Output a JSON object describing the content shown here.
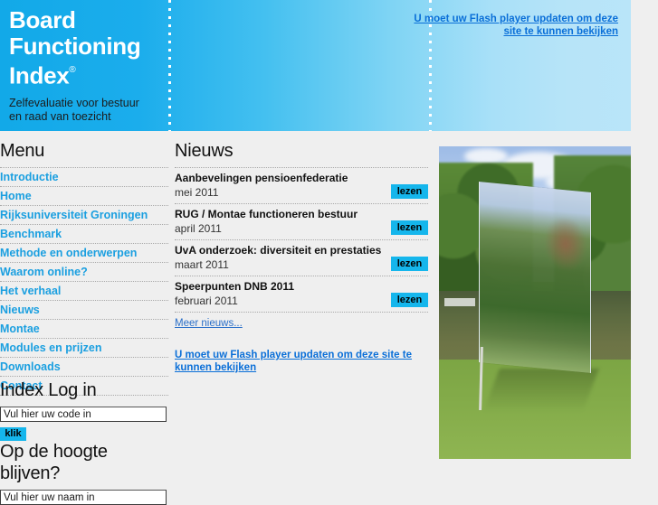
{
  "header": {
    "logo_line1": "Board",
    "logo_line2": "Functioning",
    "logo_line3": "Index",
    "logo_registered": "®",
    "tagline_line1": "Zelfevaluatie voor bestuur",
    "tagline_line2": "en raad van toezicht",
    "flash_notice": "U moet uw Flash player updaten om deze site te kunnen bekijken",
    "gradient_start": "#12a9e8",
    "gradient_end": "#b9e5f9"
  },
  "menu": {
    "title": "Menu",
    "items": [
      {
        "label": "Introductie"
      },
      {
        "label": "Home"
      },
      {
        "label": "Rijksuniversiteit Groningen"
      },
      {
        "label": "Benchmark"
      },
      {
        "label": "Methode en onderwerpen"
      },
      {
        "label": "Waarom online?"
      },
      {
        "label": "Het verhaal"
      },
      {
        "label": "Nieuws"
      },
      {
        "label": "Montae"
      },
      {
        "label": "Modules en prijzen"
      },
      {
        "label": "Downloads"
      },
      {
        "label": "Contact"
      }
    ],
    "link_color": "#1a9fe0"
  },
  "news": {
    "title": "Nieuws",
    "items": [
      {
        "title": "Aanbevelingen pensioenfederatie",
        "date": "mei 2011",
        "button": "lezen"
      },
      {
        "title": "RUG / Montae functioneren bestuur",
        "date": "april 2011",
        "button": "lezen"
      },
      {
        "title": "UvA onderzoek: diversiteit en prestaties",
        "date": "maart 2011",
        "button": "lezen"
      },
      {
        "title": "Speerpunten DNB 2011",
        "date": "februari 2011",
        "button": "lezen"
      }
    ],
    "more_link": "Meer nieuws...",
    "flash_notice": "U moet uw Flash player updaten om deze site te kunnen bekijken",
    "button_color": "#15b6ec"
  },
  "login": {
    "title": "Index Log in",
    "code_value": "Vul hier uw code in",
    "submit_label": "klik"
  },
  "newsletter": {
    "title": "Op de hoogte blijven?",
    "name_value": "Vul hier uw naam in"
  },
  "photo": {
    "alt": "Mirror panel standing on grass beside a pond in a park"
  }
}
